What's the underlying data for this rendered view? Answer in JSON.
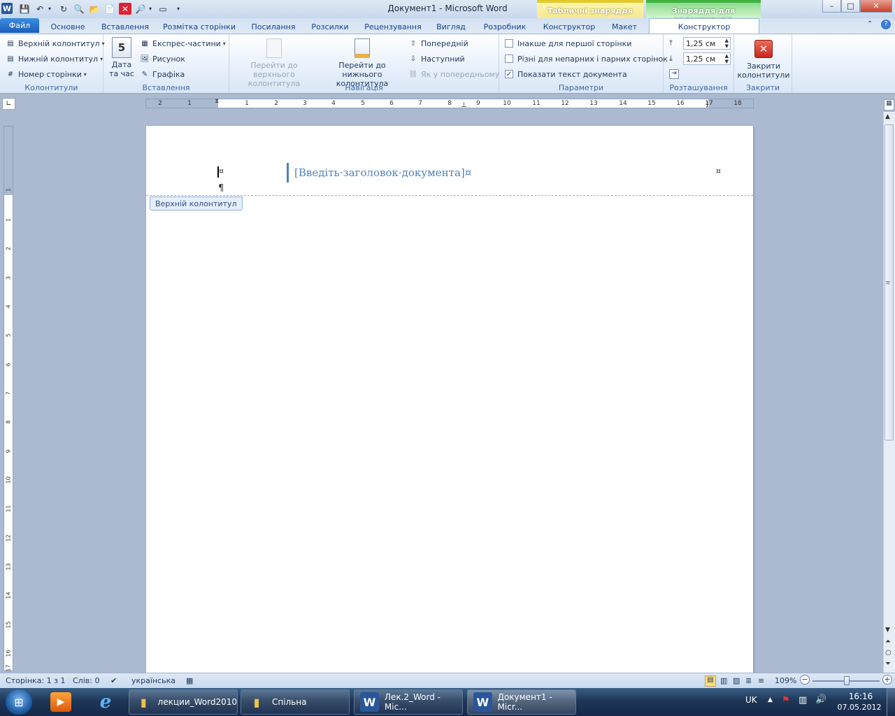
{
  "window": {
    "title": "Документ1 - Microsoft Word",
    "app_icon": "W",
    "controls": {
      "minimize": "–",
      "maximize": "□",
      "close": "✕"
    }
  },
  "context_tabs": {
    "table_tools": "Табличні знаряддя",
    "header_footer_tools": "Знаряддя для колонтитулів"
  },
  "tabs": {
    "file": "Файл",
    "items": [
      "Основне",
      "Вставлення",
      "Розмітка сторінки",
      "Посилання",
      "Розсилки",
      "Рецензування",
      "Вигляд",
      "Розробник",
      "Конструктор",
      "Макет"
    ],
    "active": "Конструктор"
  },
  "ribbon": {
    "kolontytuly": {
      "label": "Колонтитули",
      "header": "Верхній колонтитул",
      "footer": "Нижній колонтитул",
      "page_number": "Номер сторінки"
    },
    "insert": {
      "label": "Вставлення",
      "date_line1": "Дата",
      "date_line2": "та час",
      "quick_parts": "Експрес-частини",
      "picture": "Рисунок",
      "clipart": "Графіка"
    },
    "navigation": {
      "label": "Навігація",
      "go_header_1": "Перейти до верхнього",
      "go_header_2": "колонтитула",
      "go_footer_1": "Перейти до нижнього",
      "go_footer_2": "колонтитула",
      "previous": "Попередній",
      "next": "Наступний",
      "link_previous": "Як у попередньому"
    },
    "options": {
      "label": "Параметри",
      "different_first": "Інакше для першої сторінки",
      "different_odd_even": "Різні для непарних і парних сторінок",
      "show_doc_text": "Показати текст документа",
      "different_first_checked": false,
      "different_odd_even_checked": false,
      "show_doc_text_checked": true
    },
    "position": {
      "label": "Розташування",
      "header_from_top": "1,25 см",
      "footer_from_bottom": "1,25 см"
    },
    "close": {
      "label": "Закрити",
      "button_line1": "Закрити",
      "button_line2": "колонтитули"
    }
  },
  "ruler": {
    "h_ticks": [
      "2",
      "1",
      "1",
      "2",
      "3",
      "4",
      "5",
      "6",
      "7",
      "8",
      "9",
      "10",
      "11",
      "12",
      "13",
      "14",
      "15",
      "16",
      "17",
      "18"
    ],
    "v_ticks": [
      "1",
      "1",
      "2",
      "3",
      "4",
      "5",
      "6",
      "7",
      "8",
      "9",
      "10",
      "11",
      "12",
      "13",
      "14",
      "15",
      "16",
      "17"
    ]
  },
  "document": {
    "header_placeholder": "[Введіть·заголовок·документа]¤",
    "cell_mark": "¤",
    "para_mark": "¶",
    "header_tag": "Верхній колонтитул"
  },
  "status": {
    "page": "Сторінка: 1 з 1",
    "words": "Слів: 0",
    "language": "українська",
    "zoom": "109%",
    "zoom_value": 109
  },
  "taskbar": {
    "items": [
      {
        "label": "лекции_Word2010",
        "icon": "folder-icon"
      },
      {
        "label": "Спільна",
        "icon": "folder-icon"
      },
      {
        "label": "Лек.2_Word - Mic...",
        "icon": "word-icon"
      },
      {
        "label": "Документ1 - Micr...",
        "icon": "word-icon"
      }
    ],
    "lang": "UK",
    "time": "16:16",
    "date": "07.05.2012"
  }
}
